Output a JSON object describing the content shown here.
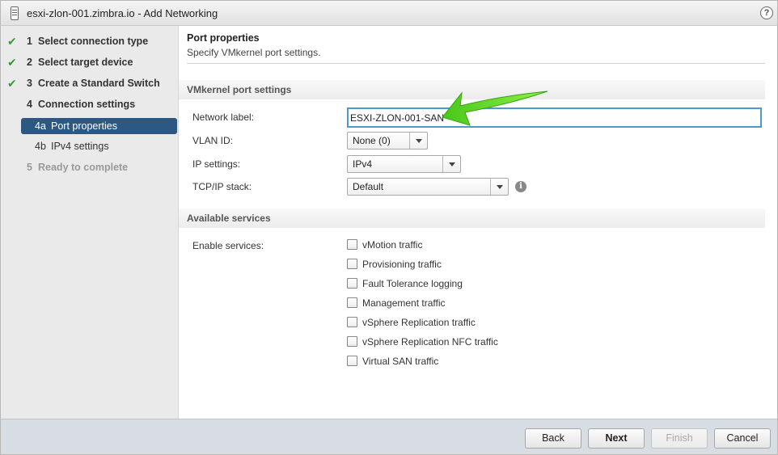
{
  "window": {
    "title": "esxi-zlon-001.zimbra.io - Add Networking",
    "help_label": "?"
  },
  "steps": [
    {
      "num": "1",
      "label": "Select connection type",
      "state": "done"
    },
    {
      "num": "2",
      "label": "Select target device",
      "state": "done"
    },
    {
      "num": "3",
      "label": "Create a Standard Switch",
      "state": "done"
    },
    {
      "num": "4",
      "label": "Connection settings",
      "state": "current-parent"
    },
    {
      "num": "4a",
      "label": "Port properties",
      "state": "active"
    },
    {
      "num": "4b",
      "label": "IPv4 settings",
      "state": "pending"
    },
    {
      "num": "5",
      "label": "Ready to complete",
      "state": "disabled"
    }
  ],
  "check_glyph": "✔",
  "page": {
    "title": "Port properties",
    "subtitle": "Specify VMkernel port settings."
  },
  "vmkernel": {
    "section_title": "VMkernel port settings",
    "network_label": {
      "label": "Network label:",
      "value": "ESXI-ZLON-001-SAN"
    },
    "vlan_id": {
      "label": "VLAN ID:",
      "value": "None (0)"
    },
    "ip_settings": {
      "label": "IP settings:",
      "value": "IPv4"
    },
    "tcpip_stack": {
      "label": "TCP/IP stack:",
      "value": "Default"
    },
    "info_glyph": "i"
  },
  "services": {
    "section_title": "Available services",
    "enable_label": "Enable services:",
    "items": [
      {
        "label": "vMotion traffic",
        "checked": false
      },
      {
        "label": "Provisioning traffic",
        "checked": false
      },
      {
        "label": "Fault Tolerance logging",
        "checked": false
      },
      {
        "label": "Management traffic",
        "checked": false
      },
      {
        "label": "vSphere Replication traffic",
        "checked": false
      },
      {
        "label": "vSphere Replication NFC traffic",
        "checked": false
      },
      {
        "label": "Virtual SAN traffic",
        "checked": false
      }
    ]
  },
  "footer": {
    "back": "Back",
    "next": "Next",
    "finish": "Finish",
    "cancel": "Cancel"
  },
  "colors": {
    "active_step": "#2d5882",
    "check": "#3a9a3a",
    "input_focus": "#4d9ac9",
    "annotation_arrow": "#66dd22"
  }
}
